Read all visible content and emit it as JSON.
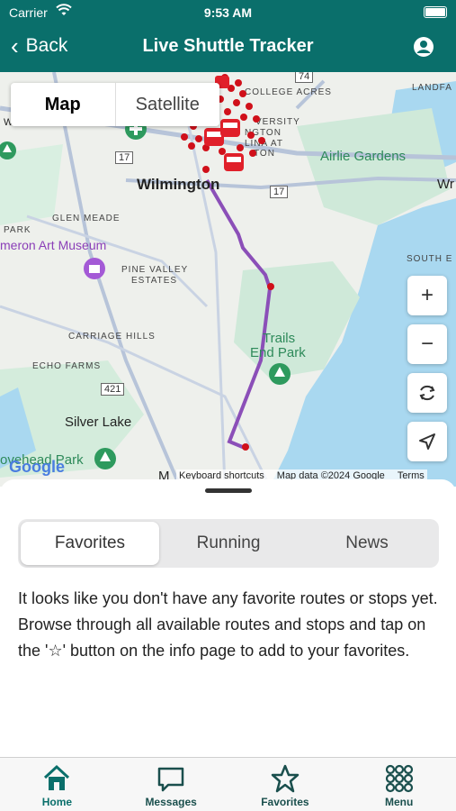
{
  "status": {
    "carrier": "Carrier",
    "time": "9:53 AM"
  },
  "nav": {
    "back_label": "Back",
    "title": "Live Shuttle Tracker"
  },
  "map": {
    "type_options": [
      "Map",
      "Satellite"
    ],
    "selected_type": "Map",
    "labels": {
      "college_acres": "COLLEGE ACRES",
      "landfall": "LANDFA",
      "university": "VERSITY",
      "ngton": "NGTON",
      "lina_at": "LINA AT",
      "ton": "TON",
      "airlie": "Airlie Gardens",
      "wilmington": "Wilmington",
      "wr": "Wr",
      "glen_meade": "GLEN MEADE",
      "park": "PARK",
      "museum": "meron Art Museum",
      "south_e": "SOUTH E",
      "pine_valley": "PINE VALLEY",
      "estates": "ESTATES",
      "trails": "Trails",
      "end_park": "End Park",
      "carriage": "CARRIAGE HILLS",
      "echo": "ECHO FARMS",
      "silver_lake": "Silver Lake",
      "head_park": "ovehead Park",
      "m": "M",
      "w": "W",
      "route_74": "74",
      "route_17a": "17",
      "route_17b": "17",
      "route_421": "421"
    },
    "attribution": {
      "shortcuts": "Keyboard shortcuts",
      "data": "Map data ©2024 Google",
      "terms": "Terms"
    },
    "logo": "Google"
  },
  "tabs_segment": {
    "items": [
      "Favorites",
      "Running",
      "News"
    ],
    "selected": "Favorites"
  },
  "empty_message": "It looks like you don't have any favorite routes or stops yet. Browse through all available routes and stops and tap on the '☆' button on the info page to add to your favorites.",
  "tabbar": [
    {
      "label": "Home",
      "icon": "home-icon"
    },
    {
      "label": "Messages",
      "icon": "chat-bubble-icon"
    },
    {
      "label": "Favorites",
      "icon": "star-icon"
    },
    {
      "label": "Menu",
      "icon": "grid-menu-icon"
    }
  ],
  "colors": {
    "brand": "#0a6f6b",
    "route": "#8b4fb8",
    "stop": "#d0101a",
    "bus": "#e0202a",
    "water": "#a9d8f0",
    "park": "#c6ecd4"
  }
}
